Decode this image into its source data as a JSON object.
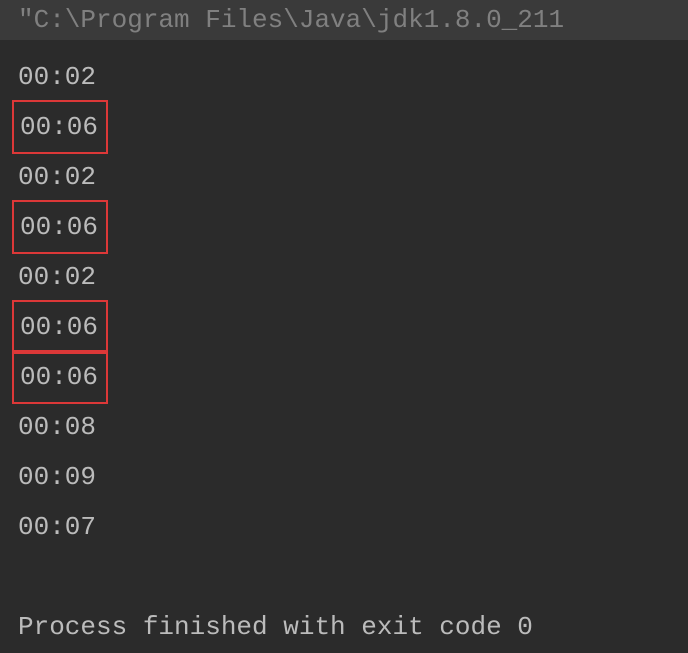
{
  "header": {
    "command": "\"C:\\Program Files\\Java\\jdk1.8.0_211"
  },
  "output": {
    "lines": [
      {
        "text": "00:02",
        "highlighted": false
      },
      {
        "text": "00:06",
        "highlighted": true
      },
      {
        "text": "00:02",
        "highlighted": false
      },
      {
        "text": "00:06",
        "highlighted": true
      },
      {
        "text": "00:02",
        "highlighted": false
      },
      {
        "text": "00:06",
        "highlighted": true
      },
      {
        "text": "00:06",
        "highlighted": true
      },
      {
        "text": "00:08",
        "highlighted": false
      },
      {
        "text": "00:09",
        "highlighted": false
      },
      {
        "text": "00:07",
        "highlighted": false
      }
    ]
  },
  "footer": {
    "message": "Process finished with exit code 0"
  }
}
